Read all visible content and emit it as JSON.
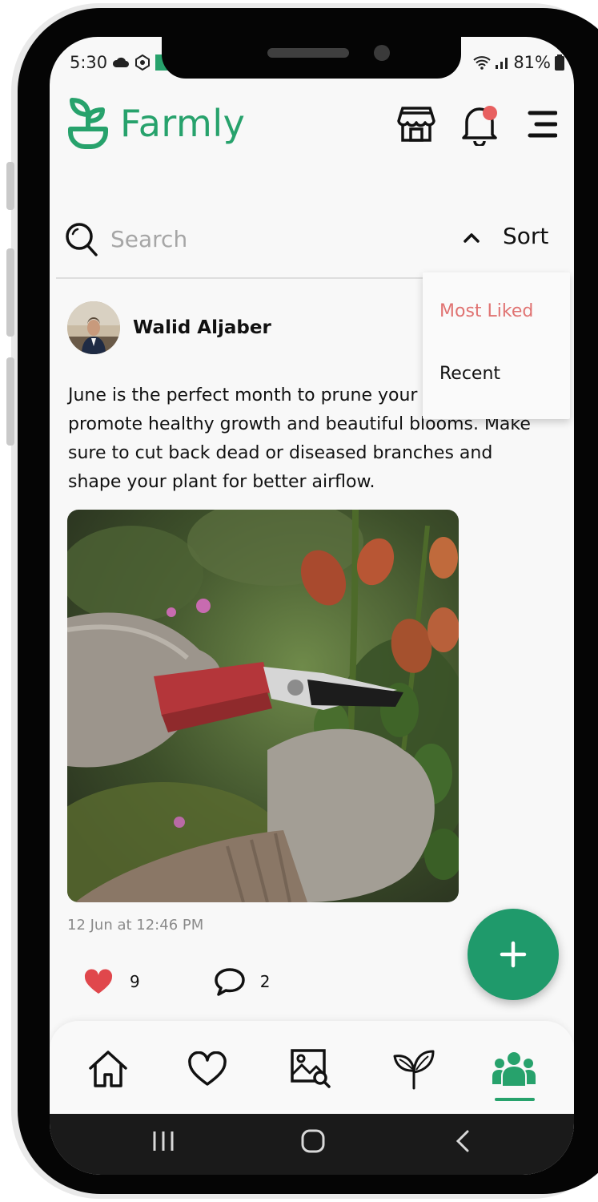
{
  "status_bar": {
    "time": "5:30",
    "battery": "81%"
  },
  "header": {
    "app_name": "Farmly"
  },
  "search": {
    "placeholder": "Search"
  },
  "sort": {
    "label": "Sort",
    "options": [
      "Most Liked",
      "Recent"
    ]
  },
  "post": {
    "author": "Walid Aljaber",
    "text": "June is the perfect month to prune your Pruning helps promote healthy growth and beautiful blooms. Make sure to cut back dead or diseased branches and shape your plant for better airflow.",
    "timestamp": "12 Jun at 12:46 PM",
    "likes": "9",
    "comments": "2"
  },
  "fab": {
    "icon": "plus-icon"
  },
  "bottom_nav": {
    "items": [
      "home-icon",
      "heart-icon",
      "image-search-icon",
      "sprout-icon",
      "community-icon"
    ],
    "active": "community-icon"
  },
  "colors": {
    "brand": "#27a26c",
    "fab": "#1f9a6b",
    "sort_active": "#e07372",
    "like": "#e0474c"
  }
}
